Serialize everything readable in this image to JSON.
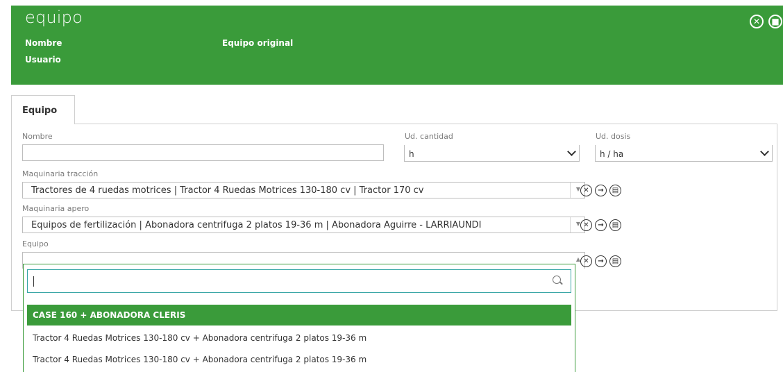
{
  "header": {
    "title": "equipo",
    "name_label": "Nombre",
    "user_label": "Usuario",
    "original_label": "Equipo original",
    "close_icon": "close-circle-icon",
    "save_icon": "save-circle-icon"
  },
  "tabs": [
    {
      "label": "Equipo",
      "active": true
    }
  ],
  "form": {
    "nombre": {
      "label": "Nombre",
      "value": ""
    },
    "ud_cantidad": {
      "label": "Ud. cantidad",
      "value": "h"
    },
    "ud_dosis": {
      "label": "Ud. dosis",
      "value": "h / ha"
    },
    "maquinaria_traccion": {
      "label": "Maquinaria tracción",
      "value": "Tractores de 4 ruedas motrices | Tractor 4 Ruedas Motrices 130-180 cv | Tractor 170 cv"
    },
    "maquinaria_apero": {
      "label": "Maquinaria apero",
      "value": "Equipos de fertilización | Abonadora centrifuga 2 platos 19-36 m | Abonadora Aguirre - LARRIAUNDI"
    },
    "equipo": {
      "label": "Equipo",
      "value": ""
    }
  },
  "row_action_icons": [
    "clear-circle-icon",
    "go-arrow-circle-icon",
    "document-circle-icon"
  ],
  "dropdown": {
    "search_value": "",
    "options": [
      {
        "label": "CASE 160 + ABONADORA CLERIS",
        "selected": true
      },
      {
        "label": "Tractor 4 Ruedas Motrices 130-180 cv + Abonadora centrifuga 2 platos 19-36 m",
        "selected": false
      },
      {
        "label": "Tractor 4 Ruedas Motrices 130-180 cv + Abonadora centrifuga 2 platos 19-36 m",
        "selected": false
      }
    ]
  },
  "colors": {
    "header_bg": "#3a9b3a",
    "selected_option": "#3a9b3a",
    "search_border": "#3aa7a7"
  }
}
